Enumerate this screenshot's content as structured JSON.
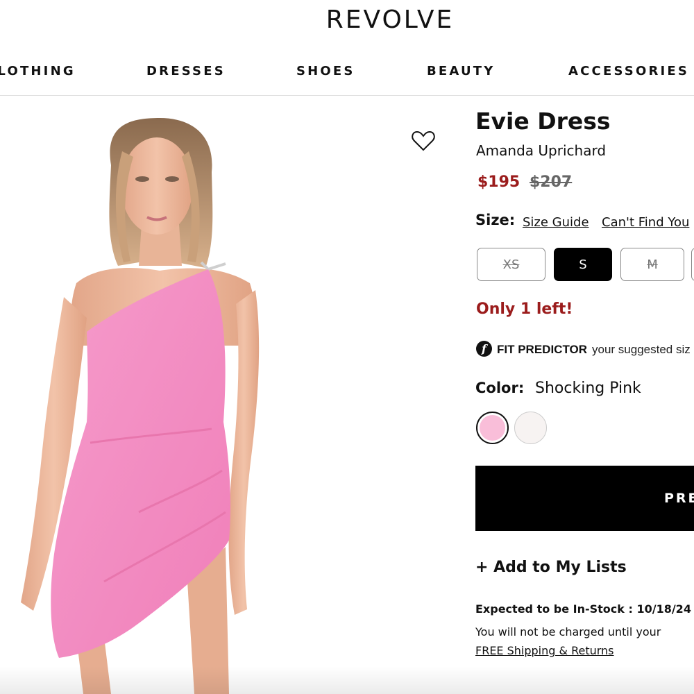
{
  "header": {
    "logo": "REVOLVE"
  },
  "nav": {
    "items": [
      {
        "label": "CLOTHING"
      },
      {
        "label": "DRESSES"
      },
      {
        "label": "SHOES"
      },
      {
        "label": "BEAUTY"
      },
      {
        "label": "ACCESSORIES"
      }
    ]
  },
  "product": {
    "title": "Evie Dress",
    "brand": "Amanda Uprichard",
    "price_sale": "$195",
    "price_original": "$207",
    "size": {
      "label": "Size:",
      "guide_link": "Size Guide",
      "cant_find_link": "Can't Find You",
      "options": [
        {
          "label": "XS",
          "state": "unavailable"
        },
        {
          "label": "S",
          "state": "selected"
        },
        {
          "label": "M",
          "state": "unavailable"
        }
      ]
    },
    "stock_note": "Only 1 left!",
    "fit_predictor": {
      "icon_letter": "f",
      "title": "FIT PREDICTOR",
      "text": "your suggested siz"
    },
    "color": {
      "label": "Color:",
      "value": "Shocking Pink",
      "swatches": [
        {
          "name": "shocking-pink",
          "hex": "#f9bed9",
          "selected": true
        },
        {
          "name": "white",
          "hex": "#f7f3f2",
          "selected": false
        }
      ]
    },
    "cta_label": "PRE",
    "add_to_lists": "+ Add to My Lists",
    "instock_note": "Expected to be In-Stock : 10/18/24",
    "charged_note": "You will not be charged until your",
    "shipping_link": "FREE Shipping & Returns"
  },
  "colors": {
    "sale_red": "#9b1c1c",
    "dress_pink": "#f48cc3",
    "cta_black": "#000000"
  }
}
